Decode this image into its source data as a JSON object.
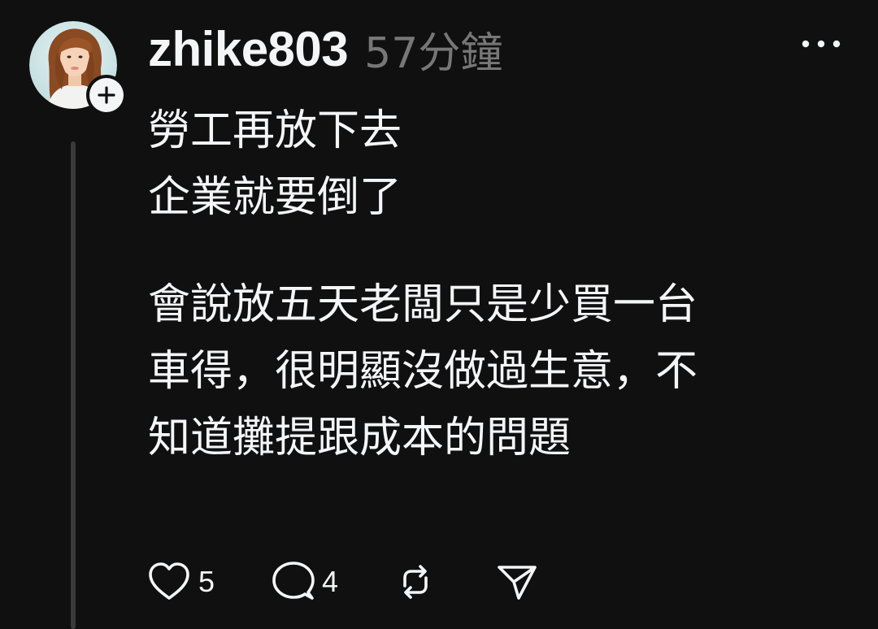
{
  "post": {
    "author": {
      "username": "zhike803",
      "avatar_icon": "user-avatar-photo",
      "follow_icon": "plus-icon"
    },
    "timestamp": "57分鐘",
    "more_icon": "more-horizontal-icon",
    "body": {
      "paragraph_1": [
        "勞工再放下去",
        "企業就要倒了"
      ],
      "paragraph_2": [
        "會說放五天老闆只是少買一台",
        "車得，很明顯沒做過生意，不",
        "知道攤提跟成本的問題"
      ]
    },
    "actions": {
      "like": {
        "icon": "heart-icon",
        "count": "5"
      },
      "reply": {
        "icon": "comment-icon",
        "count": "4"
      },
      "repost": {
        "icon": "repost-icon"
      },
      "share": {
        "icon": "send-icon"
      }
    }
  },
  "colors": {
    "background": "#101010",
    "text_primary": "#f3f5f7",
    "text_secondary": "#777777",
    "thread_line": "#3a3a3a"
  }
}
